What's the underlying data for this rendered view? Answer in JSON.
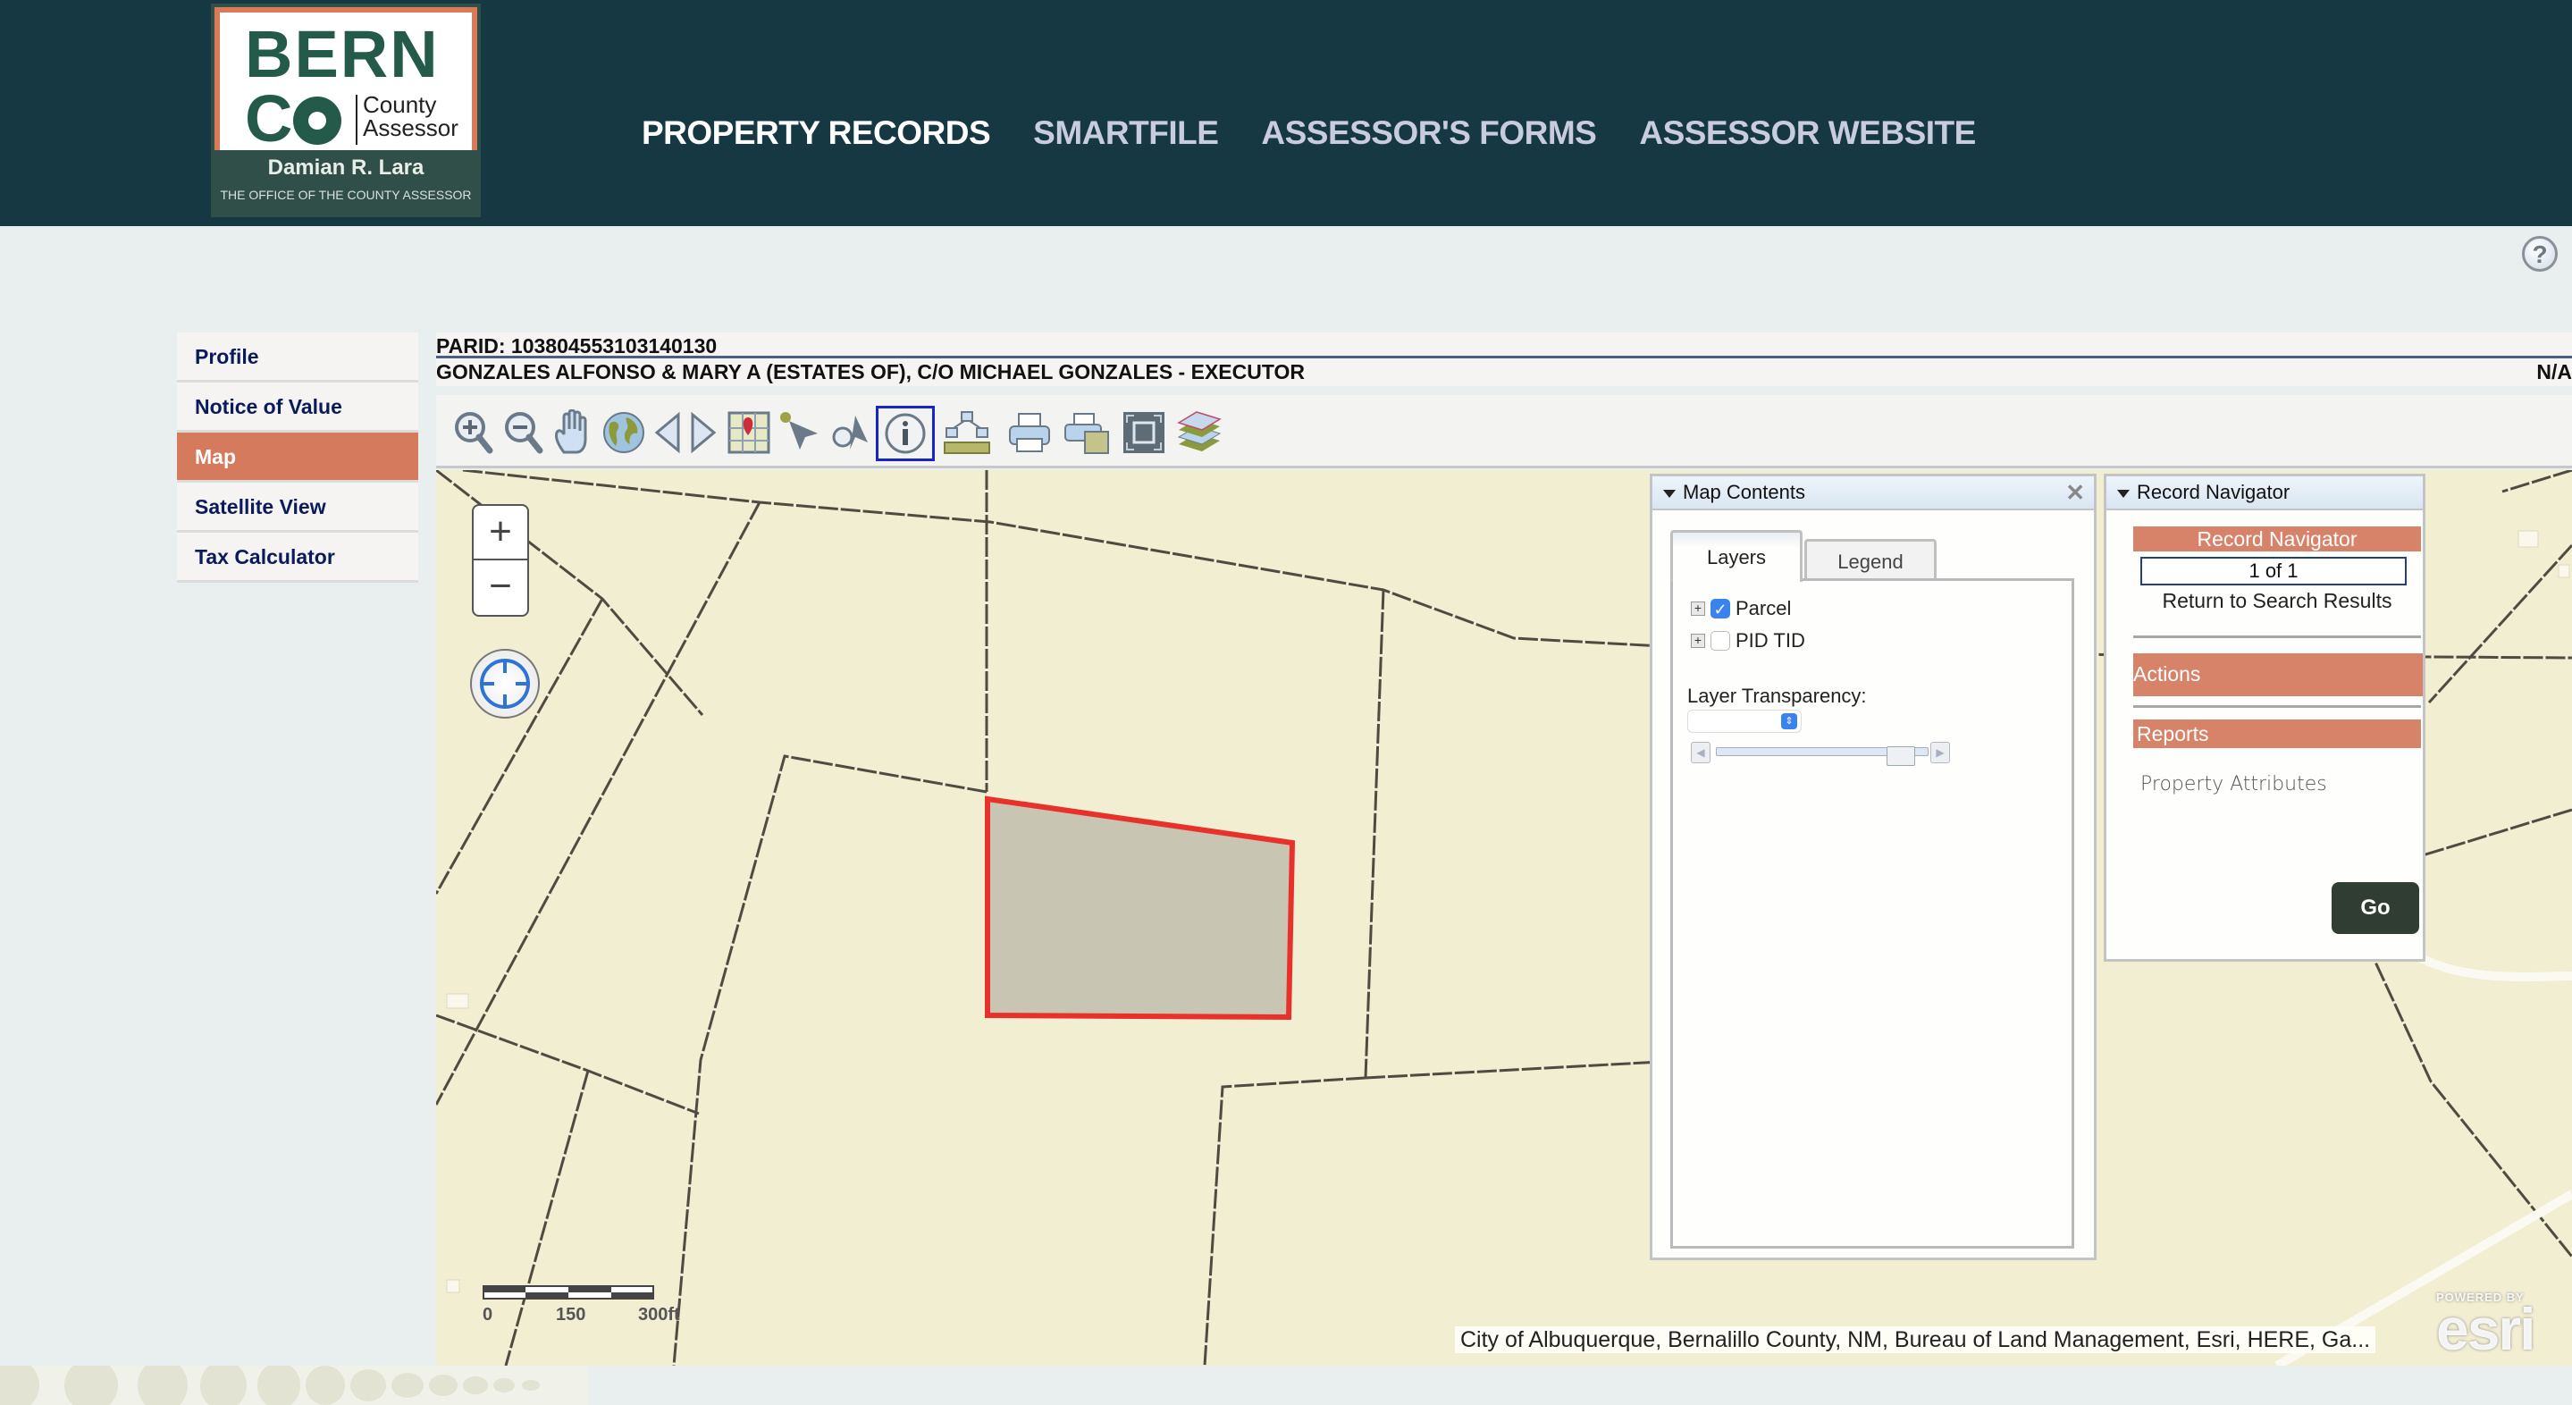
{
  "brand": {
    "logo_line1": "BERN",
    "logo_line2": "CO",
    "logo_county": "County",
    "logo_assessor": "Assessor",
    "official_name": "Damian R. Lara",
    "office": "THE OFFICE OF THE COUNTY ASSESSOR",
    "colors": {
      "header": "#153843",
      "accent": "#d67a5e",
      "logo_green": "#245a49"
    }
  },
  "nav": {
    "items": [
      {
        "label": "PROPERTY RECORDS",
        "active": true
      },
      {
        "label": "SMARTFILE",
        "active": false
      },
      {
        "label": "ASSESSOR'S FORMS",
        "active": false
      },
      {
        "label": "ASSESSOR WEBSITE",
        "active": false
      }
    ],
    "help": "?"
  },
  "sidebar": {
    "items": [
      {
        "label": "Profile"
      },
      {
        "label": "Notice of Value"
      },
      {
        "label": "Map",
        "active": true
      },
      {
        "label": "Satellite View"
      },
      {
        "label": "Tax Calculator"
      }
    ]
  },
  "record": {
    "parid": "PARID: 103804553103140130",
    "owner": "GONZALES ALFONSO & MARY A (ESTATES OF), C/O MICHAEL GONZALES - EXECUTOR",
    "status": "N/A"
  },
  "toolbar": {
    "tools": [
      "zoom-in",
      "zoom-out",
      "pan",
      "full-extent",
      "previous-extent",
      "next-extent",
      "locate-address",
      "select",
      "select-by-buffer",
      "identify",
      "measure",
      "print",
      "export",
      "fullscreen",
      "basemap-layers"
    ],
    "selected": "identify"
  },
  "map": {
    "zoom_in": "+",
    "zoom_out": "−",
    "scale": {
      "labels": [
        "0",
        "150",
        "300ft"
      ]
    },
    "attribution": "City of Albuquerque, Bernalillo County, NM, Bureau of Land Management, Esri, HERE, Ga...",
    "esri_powered": "POWERED BY",
    "esri_word": "esri",
    "highlight_color": "#e8312a"
  },
  "map_contents": {
    "title": "Map Contents",
    "close": "✕",
    "tabs": [
      {
        "label": "Layers",
        "active": true
      },
      {
        "label": "Legend",
        "active": false
      }
    ],
    "layers": [
      {
        "name": "Parcel",
        "checked": true
      },
      {
        "name": "PID TID",
        "checked": false
      }
    ],
    "transparency_label": "Layer Transparency:",
    "transparency_value": 0.92
  },
  "record_navigator": {
    "title": "Record Navigator",
    "banner": "Record Navigator",
    "count": "1 of 1",
    "return_link": "Return to Search Results",
    "actions": "Actions",
    "reports": "Reports",
    "report_selected": "Property Attributes",
    "go": "Go"
  }
}
